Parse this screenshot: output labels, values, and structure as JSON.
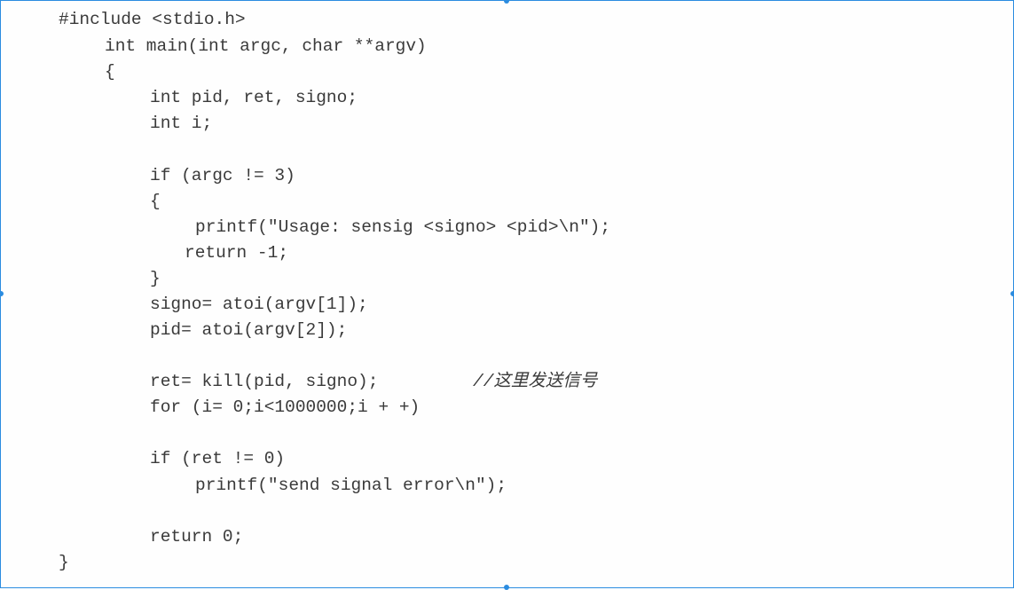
{
  "code_lines": [
    "#include <stdio.h>",
    "int main(int argc, char **argv)",
    "{",
    "int pid, ret, signo;",
    "int i;",
    "if (argc != 3)",
    "{",
    "printf(\"Usage: sensig <signo> <pid>\\n\");",
    "return -1;",
    "}",
    "signo= atoi(argv[1]);",
    "pid= atoi(argv[2]);",
    "ret= kill(pid, signo);",
    "//这里发送信号",
    "for (i= 0;i<1000000;i + +)",
    "if (ret != 0)",
    "printf(\"send signal error\\n\");",
    "return 0;",
    "}"
  ]
}
